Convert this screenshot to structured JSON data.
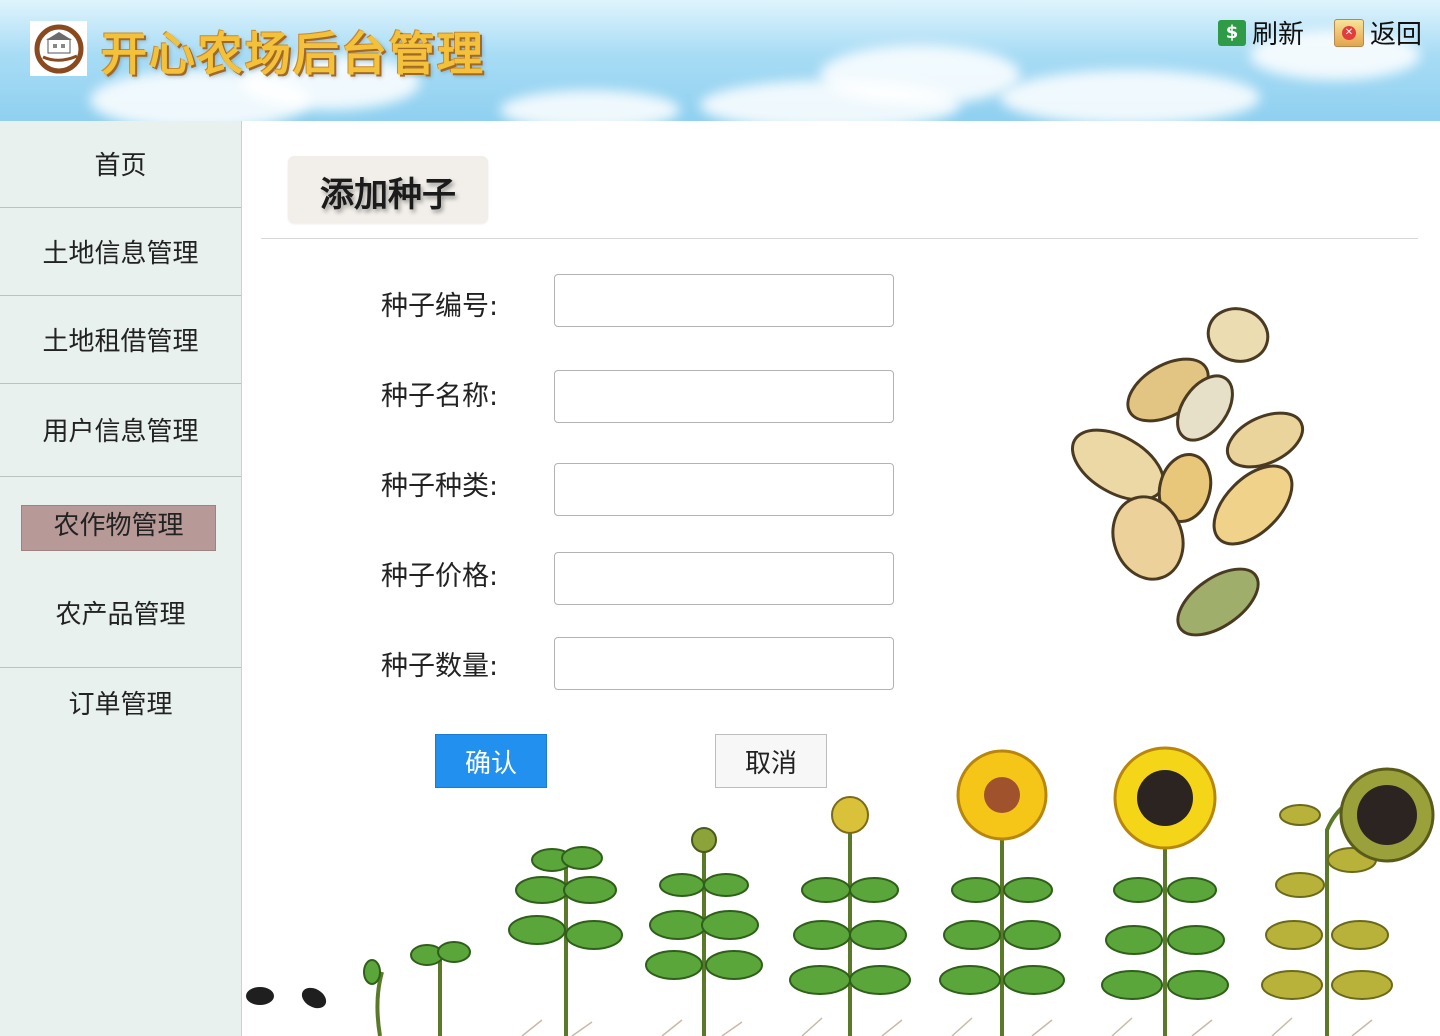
{
  "header": {
    "title": "开心农场后台管理",
    "refresh_label": "刷新",
    "back_label": "返回"
  },
  "sidebar": {
    "items": [
      {
        "label": "首页"
      },
      {
        "label": "土地信息管理"
      },
      {
        "label": "土地租借管理"
      },
      {
        "label": "用户信息管理"
      },
      {
        "label": "农作物管理",
        "active": true
      },
      {
        "label": "农产品管理"
      },
      {
        "label": "订单管理"
      }
    ]
  },
  "main": {
    "page_title": "添加种子",
    "form": {
      "fields": [
        {
          "label": "种子编号:",
          "value": ""
        },
        {
          "label": "种子名称:",
          "value": ""
        },
        {
          "label": "种子种类:",
          "value": ""
        },
        {
          "label": "种子价格:",
          "value": ""
        },
        {
          "label": "种子数量:",
          "value": ""
        }
      ],
      "confirm_label": "确认",
      "cancel_label": "取消"
    }
  },
  "icons": {
    "refresh": "refresh-icon",
    "back": "back-icon",
    "logo": "farm-logo-icon"
  },
  "colors": {
    "accent": "#2290ee",
    "active_nav": "#b79a98",
    "sidebar_bg": "#e8f1ee",
    "title": "#f4c23a"
  }
}
